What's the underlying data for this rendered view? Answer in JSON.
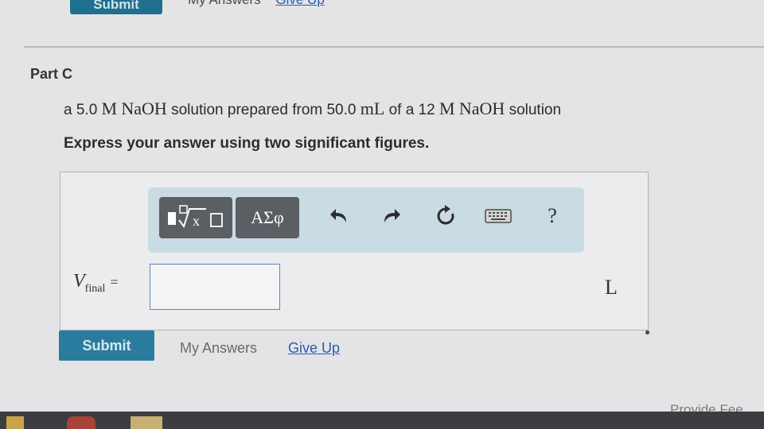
{
  "top": {
    "submit_label": "Submit",
    "my_answers": "My Answers",
    "give_up": "Give Up"
  },
  "part": {
    "title": "Part C"
  },
  "question": {
    "prefix": "a 5.0",
    "m1": "M",
    "chem1": "NaOH",
    "mid": "solution prepared from 50.0",
    "unit_ml": "mL",
    "of": "of a 12",
    "m2": "M",
    "chem2": "NaOH",
    "suffix": "solution"
  },
  "instruction": "Express your answer using two significant figures.",
  "toolbar": {
    "symbols_label": "ΑΣφ",
    "icons": [
      "templates-icon",
      "undo-icon",
      "redo-icon",
      "reset-icon",
      "keyboard-icon",
      "help-icon"
    ],
    "help_label": "?"
  },
  "answer": {
    "variable": "V",
    "subscript": "final",
    "equals": "=",
    "value": "",
    "unit": "L"
  },
  "actions": {
    "submit_label": "Submit",
    "my_answers": "My Answers",
    "give_up": "Give Up"
  },
  "footer": {
    "feedback": "Provide Fee"
  },
  "colors": {
    "accent": "#2a7c9e",
    "toolbar_bg": "#c9dbe3",
    "link": "#2a5db0"
  }
}
